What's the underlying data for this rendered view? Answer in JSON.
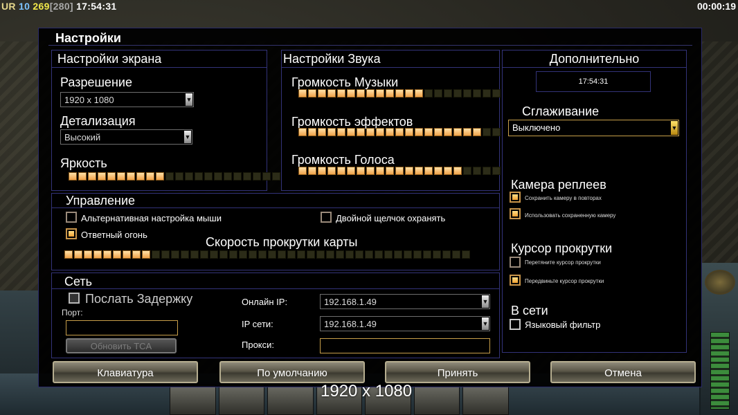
{
  "hud": {
    "top_left": {
      "faction": "UR",
      "level": "10",
      "count": "269",
      "max": "[280]",
      "clock": "17:54:31"
    },
    "top_right": "00:00:19"
  },
  "dialog": {
    "title": "Настройки",
    "screen": {
      "heading": "Настройки экрана",
      "resolution_label": "Разрешение",
      "resolution_value": "1920 x 1080",
      "detail_label": "Детализация",
      "detail_value": "Высокий",
      "brightness_label": "Яркость",
      "brightness_level": {
        "on": 10,
        "total": 22
      }
    },
    "sound": {
      "heading": "Настройки Звука",
      "music_label": "Громкость Музыки",
      "music_level": {
        "on": 13,
        "total": 22
      },
      "effects_label": "Громкость эффектов",
      "effects_level": {
        "on": 19,
        "total": 22
      },
      "voice_label": "Громкость Голоса",
      "voice_level": {
        "on": 17,
        "total": 22
      }
    },
    "controls": {
      "heading": "Управление",
      "alt_mouse": "Альтернативная настройка мыши",
      "double_click": "Двойной щелчок охранять",
      "return_fire": "Ответный огонь",
      "scroll_speed_label": "Скорость прокрутки карты",
      "scroll_level": {
        "on": 9,
        "total": 42
      }
    },
    "network": {
      "heading": "Сеть",
      "send_delay": "Послать Задержку",
      "port_label": "Порт:",
      "update_tca": "Обновить TCA",
      "online_ip_label": "Онлайн IP:",
      "online_ip_value": "192.168.1.49",
      "lan_ip_label": "IP сети:",
      "lan_ip_value": "192.168.1.49",
      "proxy_label": "Прокси:"
    },
    "extra": {
      "heading": "Дополнительно",
      "clock": "17:54:31",
      "aa_label": "Сглаживание",
      "aa_value": "Выключено",
      "replay_cam_label": "Камера реплеев",
      "save_cam": "Сохранить камеру в повторах",
      "use_cam": "Использовать сохраненную камеру",
      "scroll_cursor_label": "Курсор прокрутки",
      "drag_cursor": "Перетяните курсор прокрутки",
      "move_cursor": "Передвиньте курсор прокрутки",
      "online_label": "В сети",
      "lang_filter": "Языковый фильтр"
    },
    "buttons": {
      "keyboard": "Клавиатура",
      "defaults": "По умолчанию",
      "accept": "Принять",
      "cancel": "Отмена"
    }
  },
  "tooltip": "1920 x 1080",
  "colors": {
    "accent": "#f0a24a",
    "border": "#33337a",
    "gold": "#c9a04a"
  }
}
